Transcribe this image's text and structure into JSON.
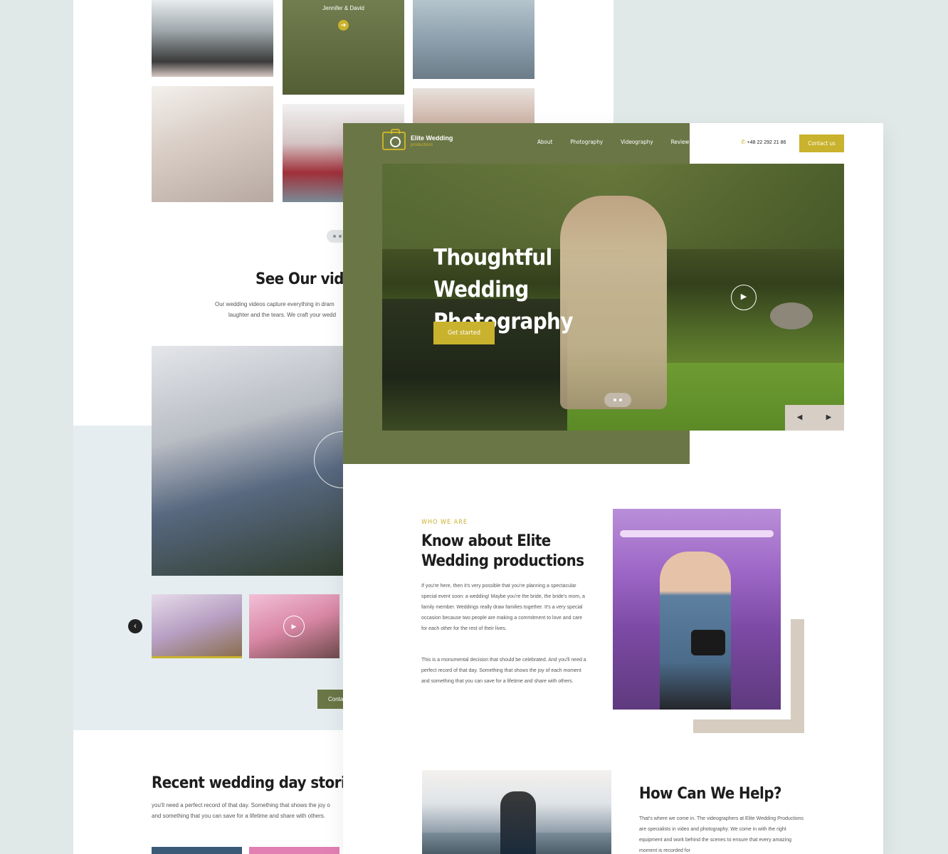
{
  "back_page": {
    "gallery_caption": "Jennifer & David",
    "video_section": {
      "title": "See Our videog",
      "text_line1": "Our wedding videos capture everything in dram",
      "text_line2": "laughter and the tears. We craft your wedd",
      "contact_label": "Contac"
    },
    "stories": {
      "title": "Recent wedding day stories",
      "text_line1": "you'll need a perfect record of that day. Something that shows the joy o",
      "text_line2": "and something that you can save for a lifetime and share with others."
    }
  },
  "front_page": {
    "logo": {
      "name": "Elite Wedding",
      "tagline": "productions"
    },
    "nav": [
      "About",
      "Photography",
      "Videography",
      "Review"
    ],
    "phone": "+48 22 292 21 86",
    "contact_button": "Contact us",
    "hero": {
      "title_line1": "Thoughtful Wedding",
      "title_line2": "Photography",
      "cta": "Get started"
    },
    "about": {
      "label": "WHO WE ARE",
      "title": "Know about Elite Wedding productions",
      "paragraph1": "If you're here, then it's very possible that you're planning a spectacular special event soon: a wedding! Maybe you're the bride, the bride's mom, a family member. Weddings really draw families together. It's a very special occasion because two people are making a commitment to love and care for each other for the rest of their lives.",
      "paragraph2": "This is a monumental decision that should be celebrated. And you'll need a perfect record of that day. Something that shows the joy of each moment and something that you can save for a lifetime and share with others."
    },
    "help": {
      "title": "How Can We Help?",
      "paragraph": "That's where we come in. The videographers at Elite Wedding Productions are specialists in video and photography. We come in with the right equipment and work behind the scenes to ensure that every amazing moment is recorded for"
    }
  },
  "colors": {
    "olive": "#6b7646",
    "gold": "#c9b22d",
    "sand": "#d6ccc0",
    "background": "#e0e9e8"
  }
}
